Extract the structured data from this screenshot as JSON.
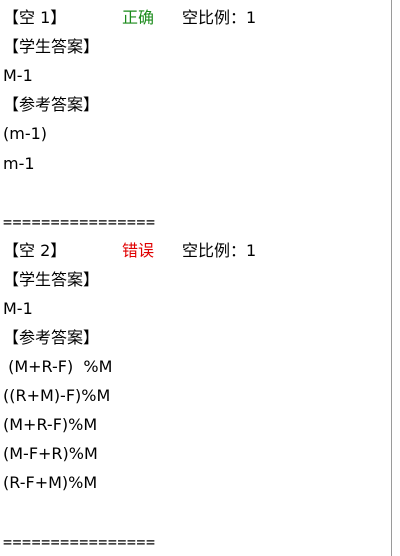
{
  "blank1": {
    "title": "【空 1】",
    "status": "正确",
    "ratio": "空比例：1",
    "student_header": "【学生答案】",
    "student_answer": "M-1",
    "reference_header": "【参考答案】",
    "reference_answers": [
      "(m-1)",
      "m-1"
    ]
  },
  "separator1": "================",
  "blank2": {
    "title": "【空 2】",
    "status": "错误",
    "ratio": "空比例：1",
    "student_header": "【学生答案】",
    "student_answer": "M-1",
    "reference_header": "【参考答案】",
    "reference_answers": [
      " (M+R-F)  %M",
      "((R+M)-F)%M",
      "(M+R-F)%M",
      "(M-F+R)%M",
      "(R-F+M)%M"
    ]
  },
  "separator2": "================",
  "colors": {
    "correct": "#1a8a1a",
    "wrong": "#e00000",
    "text": "#000000"
  }
}
